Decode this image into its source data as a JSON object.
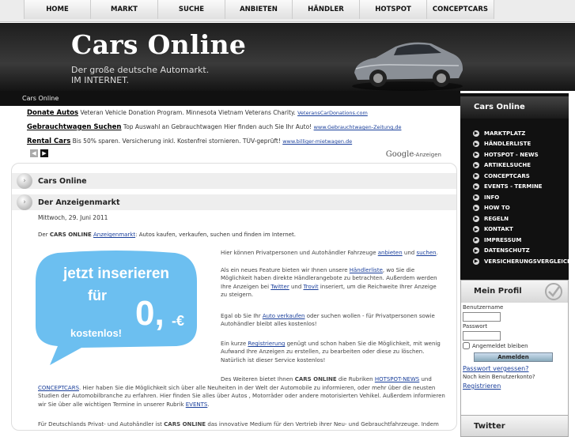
{
  "nav": [
    "HOME",
    "MARKT",
    "SUCHE",
    "ANBIETEN",
    "HÄNDLER",
    "HOTSPOT",
    "CONCEPTCARS"
  ],
  "header": {
    "title": "Cars Online",
    "sub1": "Der große deutsche Automarkt.",
    "sub2": "IM INTERNET."
  },
  "breadcrumb": "Cars Online",
  "ads": [
    {
      "title": "Donate Autos",
      "text": "Veteran Vehicle Donation Program. Minnesota Vietnam Veterans Charity.",
      "url": "VeteransCarDonations.com"
    },
    {
      "title": "Gebrauchtwagen Suchen",
      "text": "Top Auswahl an Gebrauchtwagen Hier finden auch Sie Ihr Auto!",
      "url": "www.Gebrauchtwagen-Zeitung.de"
    },
    {
      "title": "Rental Cars",
      "text": "Bis 50% sparen. Versicherung inkl. Kostenfrei stornieren. TÜV-geprüft!",
      "url": "www.billiger-mietwagen.de"
    }
  ],
  "google_ads": {
    "brand": "Google",
    "label": "-Anzeigen"
  },
  "main": {
    "h1": "Cars Online",
    "h2": "Der Anzeigenmarkt",
    "date": "Mittwoch, 29. Juni 2011",
    "intro": {
      "a": "Der ",
      "b": "CARS ONLINE",
      "c": "Anzeigenmarkt",
      "d": ": Autos kaufen, verkaufen, suchen und finden im Internet."
    },
    "bubble": {
      "l1": "jetzt inserieren",
      "l2": "für",
      "num": "0,",
      "suffix": "-€",
      "l3": "kostenlos!"
    },
    "p1": {
      "a": "Hier können Privatpersonen und Autohändler Fahrzeuge ",
      "b": "anbieten",
      "c": " und ",
      "d": "suchen",
      "e": "."
    },
    "p2": {
      "a": "Als ein neues Feature bieten wir Ihnen unsere ",
      "b": "Händlerliste",
      "c": ", wo Sie die Möglichkeit haben direkte Händlerangebote zu betrachten. Außerdem werden Ihre Anzeigen bei ",
      "d": "Twitter",
      "e": " und ",
      "f": "Trovit",
      "g": " inseriert, um die Reichweite Ihrer Anzeige zu steigern."
    },
    "p3": {
      "a": "Egal ob Sie Ihr ",
      "b": "Auto verkaufen",
      "c": " oder suchen wollen - für Privatpersonen sowie Autohändler bleibt alles kostenlos!"
    },
    "p4": {
      "a": "Ein kurze ",
      "b": " Registrierung",
      "c": " genügt und schon haben Sie die Möglichkeit, mit wenig Aufwand Ihre Anzeigen zu erstellen, zu bearbeiten oder diese zu löschen. Natürlich ist dieser Service kostenlos!"
    },
    "p5": {
      "a": "Des Weiteren bietet Ihnen ",
      "b": "CARS ONLINE",
      "c": " die Rubriken ",
      "d": "HOTSPOT-NEWS",
      "e": " und"
    },
    "p6": {
      "a": "CONCEPTCARS",
      "b": ". Hier haben Sie die Möglichkeit sich über alle Neuheiten in der Welt der Automobile zu informieren, oder mehr über die neusten Studien der Automobilbranche zu erfahren. Hier finden Sie alles über Autos , Motorräder oder andere motorisierten Vehikel. Außerdem informieren wir Sie über alle wichtigen Termine in unserer Rubrik ",
      "c": "EVENTS",
      "d": "."
    },
    "p7": {
      "a": "Für Deutschlands Privat- und Autohändler ist ",
      "b": "CARS ONLINE",
      "c": " das innovative Medium für den Vertrieb ihrer Neu- und Gebrauchtfahrzeuge. Indem"
    }
  },
  "sidebar": {
    "title": "Cars Online",
    "menu": [
      "MARKTPLATZ",
      "HÄNDLERLISTE",
      "HOTSPOT - NEWS",
      "ARTIKELSUCHE",
      "CONCEPTCARS",
      "EVENTS - TERMINE",
      "INFO",
      "HOW TO",
      "REGELN",
      "KONTAKT",
      "IMPRESSUM",
      "DATENSCHUTZ",
      "VERSICHERUNGSVERGLEICH"
    ],
    "profil": {
      "title": "Mein Profil",
      "user": "Benutzername",
      "pass": "Passwort",
      "remember": "Angemeldet bleiben",
      "login": "Anmelden",
      "forgot": "Passwort vergessen?",
      "noacc": "Noch kein Benutzerkonto?",
      "register": "Registrieren"
    },
    "twitter": "Twitter"
  },
  "colors": {
    "link": "#1a3f9b",
    "bubble": "#6cbff0",
    "sidebar": "#111111"
  }
}
